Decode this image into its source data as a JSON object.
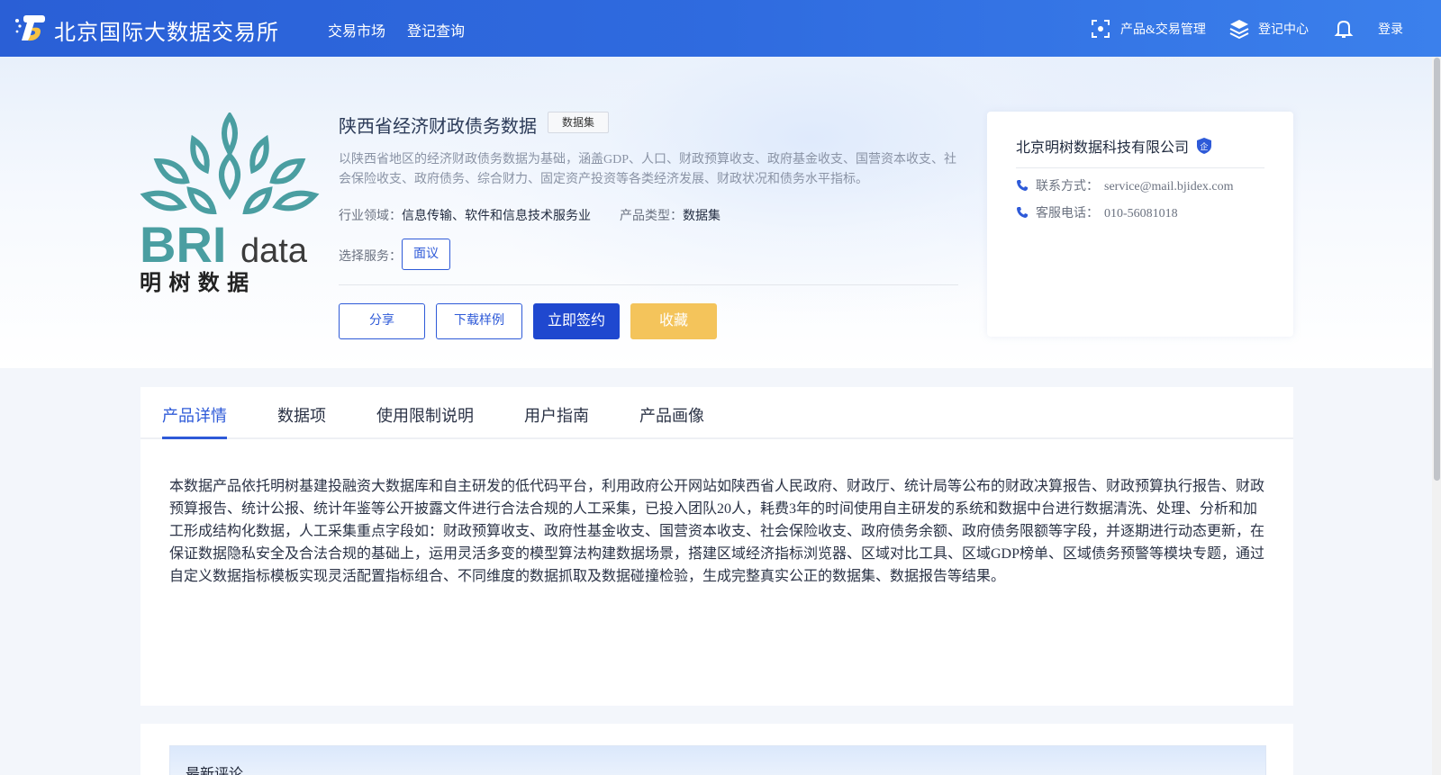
{
  "header": {
    "site_title": "北京国际大数据交易所",
    "nav": [
      "交易市场",
      "登记查询"
    ],
    "product_mgmt_label": "产品&交易管理",
    "registry_center_label": "登记中心",
    "login_label": "登录"
  },
  "product": {
    "title": "陕西省经济财政债务数据",
    "type_badge": "数据集",
    "description": "以陕西省地区的经济财政债务数据为基础，涵盖GDP、人口、财政预算收支、政府基金收支、国营资本收支、社会保险收支、政府债务、综合财力、固定资产投资等各类经济发展、财政状况和债务水平指标。",
    "industry_label": "行业领域：",
    "industry_value": "信息传输、软件和信息技术服务业",
    "product_type_label": "产品类型：",
    "product_type_value": "数据集",
    "service_label": "选择服务：",
    "service_option": "面议",
    "buttons": {
      "share": "分享",
      "download_sample": "下载样例",
      "sign_now": "立即签约",
      "favorite": "收藏"
    }
  },
  "brand_logo": {
    "wordmark_bold": "BRI",
    "wordmark_light": "data",
    "chinese": "明 树 数 据"
  },
  "company": {
    "name": "北京明树数据科技有限公司",
    "verified_badge": "企",
    "contact_label": "联系方式：",
    "contact_value": "service@mail.bjidex.com",
    "phone_label": "客服电话：",
    "phone_value": "010-56081018"
  },
  "tabs": [
    {
      "label": "产品详情",
      "active": true
    },
    {
      "label": "数据项",
      "active": false
    },
    {
      "label": "使用限制说明",
      "active": false
    },
    {
      "label": "用户指南",
      "active": false
    },
    {
      "label": "产品画像",
      "active": false
    }
  ],
  "detail_text": "本数据产品依托明树基建投融资大数据库和自主研发的低代码平台，利用政府公开网站如陕西省人民政府、财政厅、统计局等公布的财政决算报告、财政预算执行报告、财政预算报告、统计公报、统计年鉴等公开披露文件进行合法合规的人工采集，已投入团队20人，耗费3年的时间使用自主研发的系统和数据中台进行数据清洗、处理、分析和加工形成结构化数据，人工采集重点字段如：财政预算收支、政府性基金收支、国营资本收支、社会保险收支、政府债务余额、政府债务限额等字段，并逐期进行动态更新，在保证数据隐私安全及合法合规的基础上，运用灵活多变的模型算法构建数据场景，搭建区域经济指标浏览器、区域对比工具、区域GDP榜单、区域债务预警等模块专题，通过自定义数据指标模板实现灵活配置指标组合、不同维度的数据抓取及数据碰撞检验，生成完整真实公正的数据集、数据报告等结果。",
  "comments": {
    "title": "最新评论"
  },
  "colors": {
    "primary": "#2e5ad8",
    "header_bg": "#2f6bdf",
    "favorite": "#f4c45b",
    "logo_teal": "#4a9ea1"
  }
}
